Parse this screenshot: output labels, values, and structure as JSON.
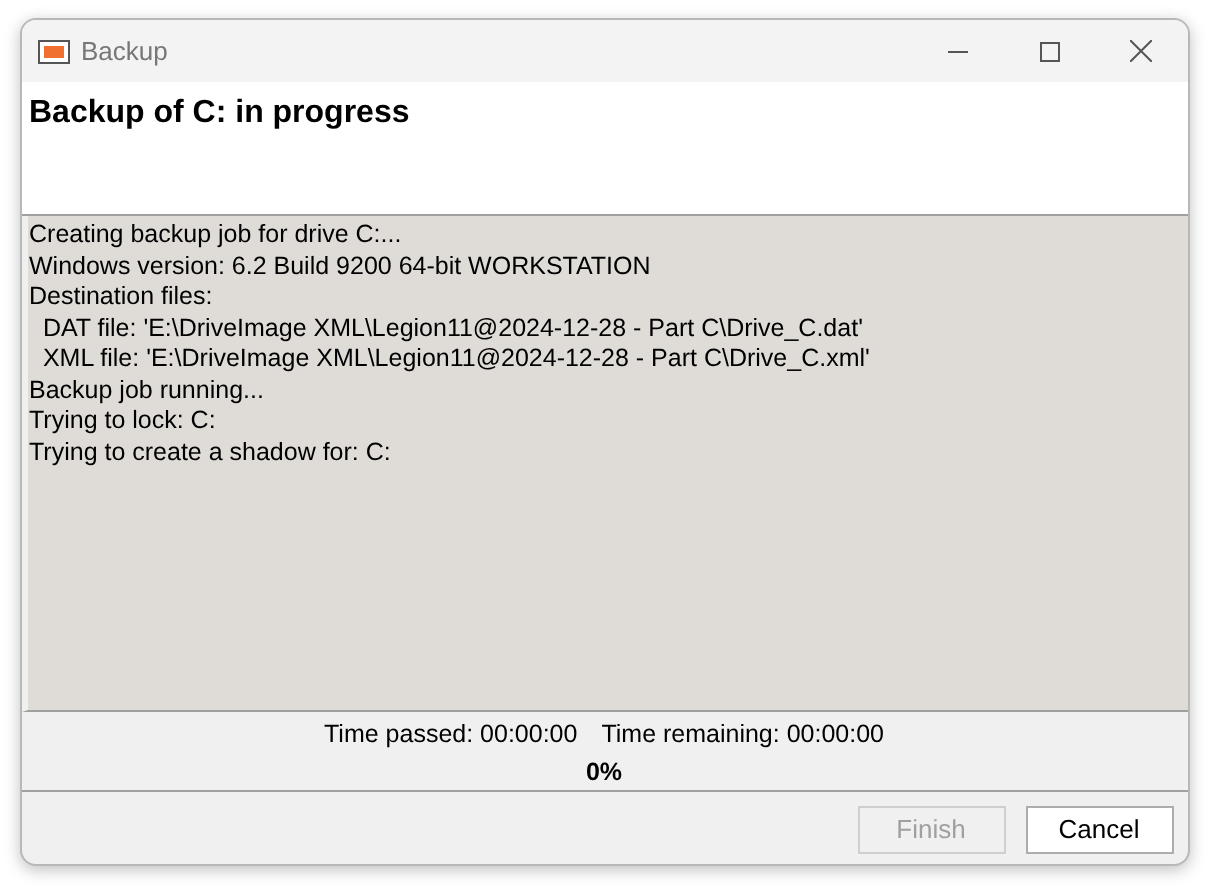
{
  "window": {
    "title": "Backup"
  },
  "header": {
    "title": "Backup of C: in progress"
  },
  "log": [
    "Creating backup job for drive C:...",
    "Windows version: 6.2 Build 9200 64-bit WORKSTATION",
    "Destination files:",
    "  DAT file: 'E:\\DriveImage XML\\Legion11@2024-12-28 - Part C\\Drive_C.dat'",
    "  XML file: 'E:\\DriveImage XML\\Legion11@2024-12-28 - Part C\\Drive_C.xml'",
    "Backup job running...",
    "Trying to lock: C:",
    "Trying to create a shadow for: C:"
  ],
  "status": {
    "time_passed": "Time passed: 00:00:00",
    "time_remaining": "Time remaining: 00:00:00",
    "percent": "0%"
  },
  "buttons": [
    {
      "label": "Finish",
      "disabled": true
    },
    {
      "label": "Cancel",
      "disabled": false
    }
  ]
}
